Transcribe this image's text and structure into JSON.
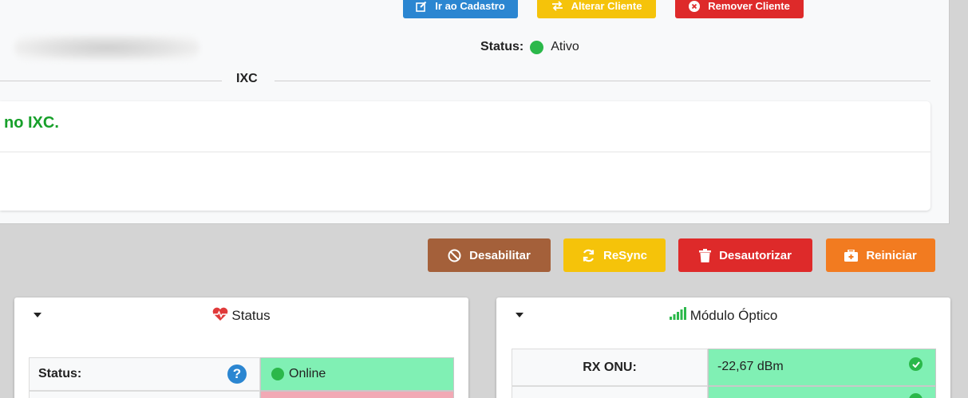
{
  "header": {
    "buttons": {
      "cadastro": "Ir ao Cadastro",
      "alterar": "Alterar Cliente",
      "remover": "Remover Cliente"
    },
    "status_label": "Status:",
    "status_value": "Ativo",
    "status_color": "#2bb84a"
  },
  "ixc": {
    "section_title": "IXC",
    "message": "no IXC."
  },
  "actions": {
    "desabilitar": "Desabilitar",
    "resync": "ReSync",
    "desautorizar": "Desautorizar",
    "reiniciar": "Reiniciar"
  },
  "status_card": {
    "title": "Status",
    "icon": "heartbeat-icon",
    "rows": [
      {
        "label": "Status:",
        "value": "Online",
        "state_color": "#80f0b4"
      },
      {
        "label": "",
        "value": "",
        "state_color": "#f2a9b5"
      }
    ]
  },
  "optico_card": {
    "title": "Módulo Óptico",
    "icon": "signal-bars-icon",
    "rows": [
      {
        "label": "RX ONU:",
        "value": "-22,67 dBm",
        "state_color": "#80f0b4"
      },
      {
        "label": "",
        "value": "",
        "state_color": "#80f0b4"
      }
    ]
  },
  "colors": {
    "blue": "#2b86d1",
    "yellow": "#f5c30a",
    "red": "#de2a2a",
    "brown": "#a4603a",
    "orange": "#f27b20",
    "green_text": "#17a02a"
  }
}
